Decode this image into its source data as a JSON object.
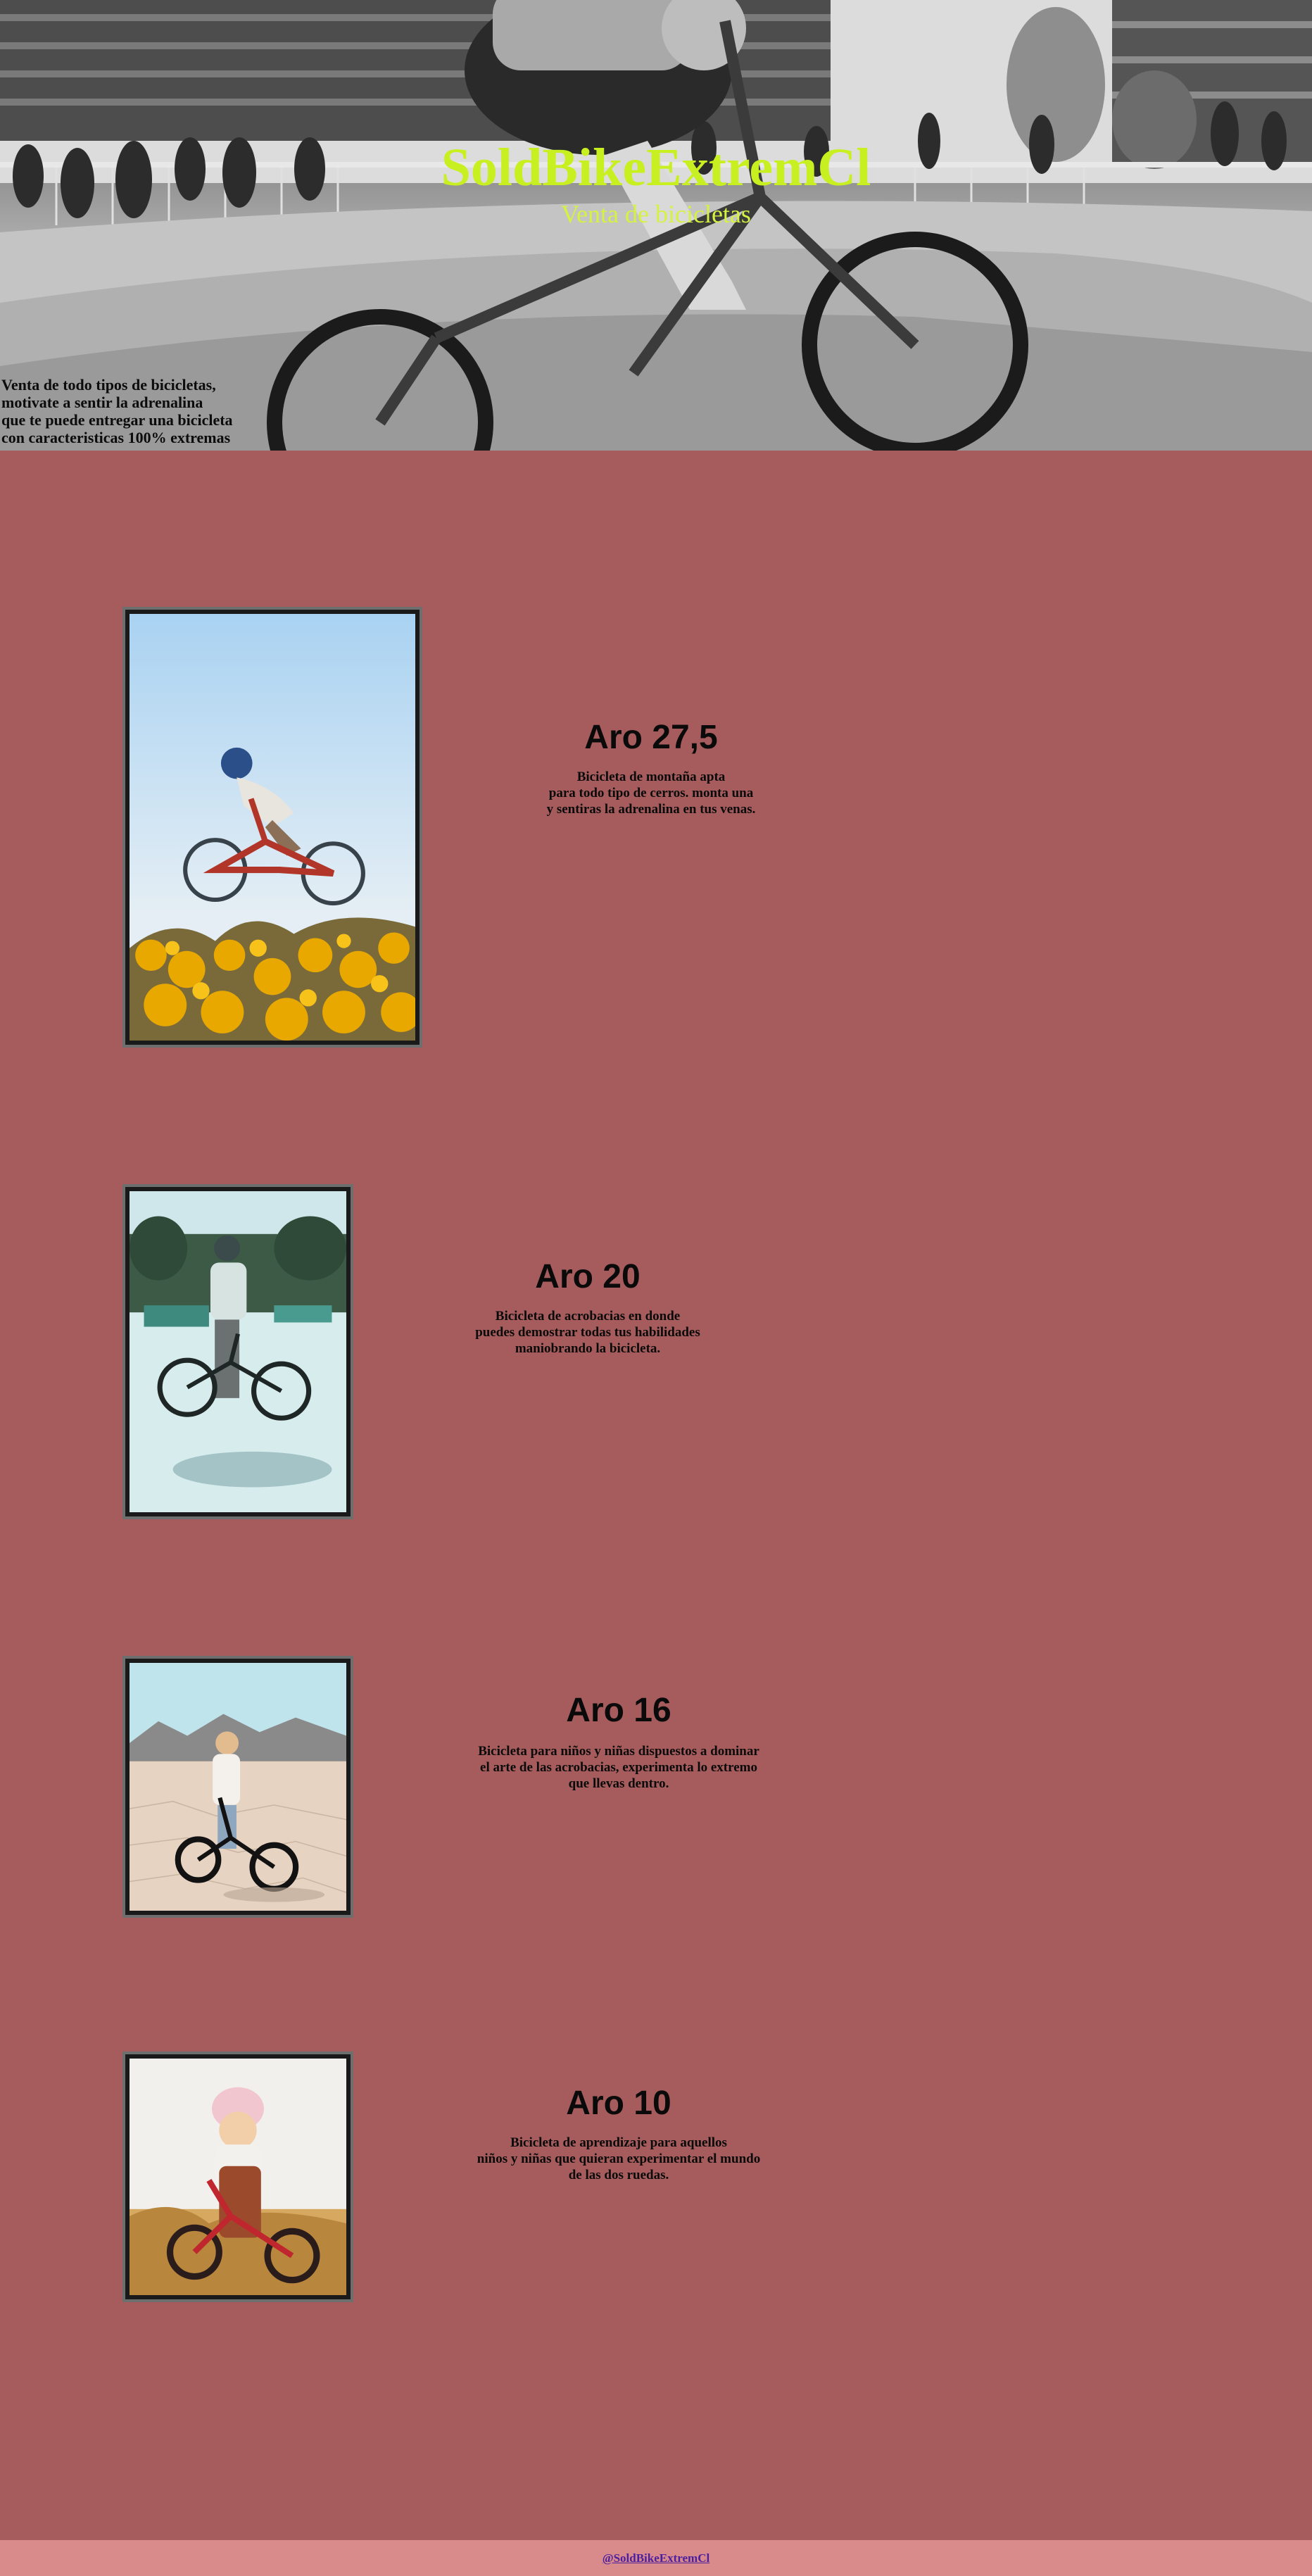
{
  "hero": {
    "title": "SoldBikeExtremCl",
    "subtitle": "Venta de bicicletas",
    "tagline_lines": [
      "Venta de todo tipos de bicicletas,",
      "motivate a sentir la adrenalina",
      "que te puede entregar una bicicleta",
      "con caracteristicas 100% extremas"
    ]
  },
  "products": [
    {
      "title": "Aro 27,5",
      "description_lines": [
        "Bicicleta de montaña apta",
        "para todo tipo de cerros. monta una",
        "y sentiras la adrenalina en tus venas."
      ]
    },
    {
      "title": "Aro 20",
      "description_lines": [
        "Bicicleta de acrobacias en donde",
        "puedes demostrar todas tus habilidades",
        "maniobrando la bicicleta."
      ]
    },
    {
      "title": "Aro 16",
      "description_lines": [
        "Bicicleta para niños y niñas dispuestos a dominar",
        "el arte de las acrobacias, experimenta lo extremo",
        "que llevas dentro."
      ]
    },
    {
      "title": "Aro 10",
      "description_lines": [
        "Bicicleta de aprendizaje para aquellos",
        "niños y niñas que quieran experimentar el mundo",
        "de las dos ruedas."
      ]
    }
  ],
  "footer": {
    "link_text": "@SoldBikeExtremCl"
  },
  "colors": {
    "page_background": "#a65c5c",
    "hero_title": "#c8f020",
    "footer_background": "#d98a8a",
    "footer_link": "#4b1fa0"
  }
}
